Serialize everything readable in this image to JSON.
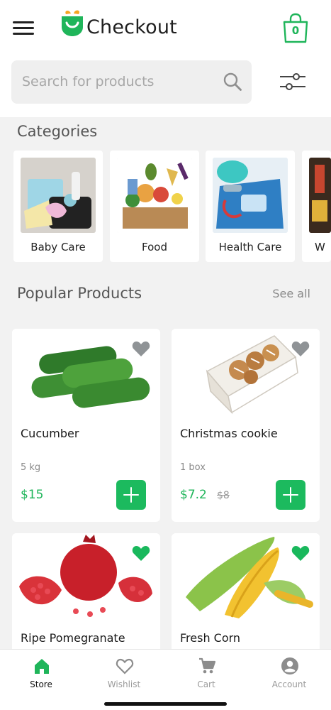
{
  "header": {
    "brand": "Checkout",
    "cart_count": "0",
    "logo_icon": "basket-smile-logo",
    "menu_icon": "hamburger-menu-icon",
    "cart_icon": "shopping-bag-icon"
  },
  "search": {
    "placeholder": "Search for products",
    "value": "",
    "icon": "search-icon",
    "filter_icon": "sliders-filter-icon"
  },
  "categories": {
    "title": "Categories",
    "items": [
      {
        "label": "Baby Care"
      },
      {
        "label": "Food"
      },
      {
        "label": "Health Care"
      },
      {
        "label": "W"
      }
    ]
  },
  "popular": {
    "title": "Popular Products",
    "see_all": "See all",
    "products": [
      {
        "name": "Cucumber",
        "unit": "5 kg",
        "price": "$15",
        "old_price": "",
        "favorite": false
      },
      {
        "name": "Christmas cookie",
        "unit": "1 box",
        "price": "$7.2",
        "old_price": "$8",
        "favorite": false
      },
      {
        "name": "Ripe Pomegranate",
        "favorite": true
      },
      {
        "name": "Fresh Corn",
        "favorite": true
      }
    ]
  },
  "tabbar": {
    "tabs": [
      {
        "label": "Store",
        "icon": "home-icon",
        "active": true
      },
      {
        "label": "Wishlist",
        "icon": "heart-outline-icon",
        "active": false
      },
      {
        "label": "Cart",
        "icon": "cart-icon",
        "active": false
      },
      {
        "label": "Account",
        "icon": "account-circle-icon",
        "active": false
      }
    ]
  },
  "colors": {
    "accent": "#1fb55a",
    "heart_inactive": "#8f9396",
    "heart_active": "#19b85c",
    "background": "#f2f2f2"
  }
}
